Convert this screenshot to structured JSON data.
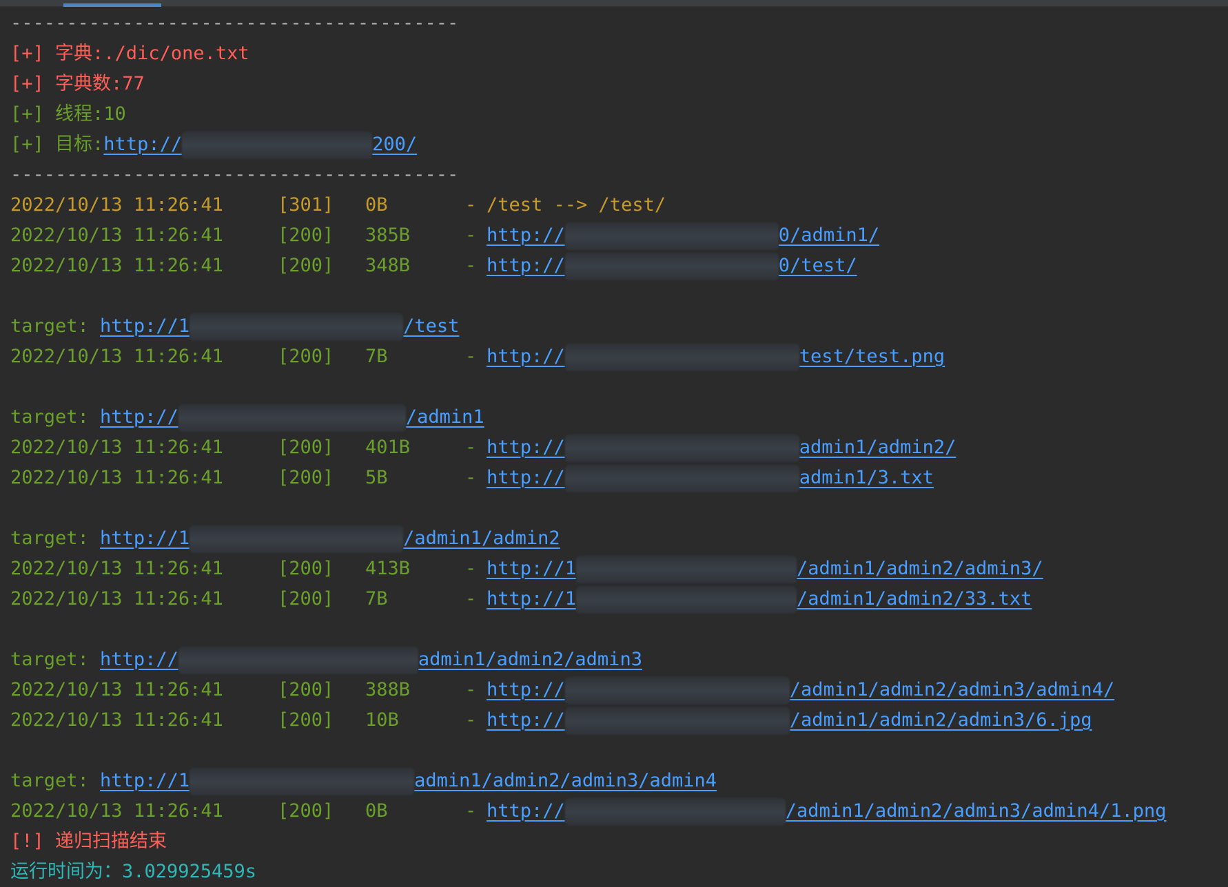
{
  "colors": {
    "background": "#2b2b2b",
    "error": "#ff5f56",
    "info": "#6a9f2b",
    "redirect": "#c49a2b",
    "link": "#4a9eff",
    "runtime": "#2fb6b6"
  },
  "header": {
    "separator": "----------------------------------------",
    "dict_prefix": "[+] ",
    "dict_label": "字典:",
    "dict_value": "./dic/one.txt",
    "dict_count_prefix": "[+] ",
    "dict_count_label": "字典数:",
    "dict_count_value": "77",
    "threads_prefix": "[+] ",
    "threads_label": "线程:",
    "threads_value": "10",
    "target_prefix": "[+] ",
    "target_label": "目标:",
    "target_url_start": "http://",
    "target_url_end": "200/"
  },
  "first_block": [
    {
      "date": "2022/10/13 11:26:41",
      "code": "[301]",
      "size": "0B",
      "dash": "-",
      "text": "/test --> /test/",
      "type": "redirect"
    },
    {
      "date": "2022/10/13 11:26:41",
      "code": "[200]",
      "size": "385B",
      "dash": "-",
      "url_start": "http://",
      "url_end": "0/admin1/",
      "type": "link"
    },
    {
      "date": "2022/10/13 11:26:41",
      "code": "[200]",
      "size": "348B",
      "dash": "-",
      "url_start": "http://",
      "url_end": "0/test/",
      "type": "link"
    }
  ],
  "targets": [
    {
      "label": "target: ",
      "url_start": "http://1",
      "url_end": "/test",
      "rows": [
        {
          "date": "2022/10/13 11:26:41",
          "code": "[200]",
          "size": "7B",
          "dash": "-",
          "url_start": "http://",
          "url_end": "test/test.png"
        }
      ]
    },
    {
      "label": "target: ",
      "url_start": "http://",
      "url_end": "/admin1",
      "rows": [
        {
          "date": "2022/10/13 11:26:41",
          "code": "[200]",
          "size": "401B",
          "dash": "-",
          "url_start": "http://",
          "url_end": "admin1/admin2/"
        },
        {
          "date": "2022/10/13 11:26:41",
          "code": "[200]",
          "size": "5B",
          "dash": "-",
          "url_start": "http://",
          "url_end": "admin1/3.txt"
        }
      ]
    },
    {
      "label": "target: ",
      "url_start": "http://1",
      "url_end": "/admin1/admin2",
      "rows": [
        {
          "date": "2022/10/13 11:26:41",
          "code": "[200]",
          "size": "413B",
          "dash": "-",
          "url_start": "http://1",
          "url_end": "/admin1/admin2/admin3/"
        },
        {
          "date": "2022/10/13 11:26:41",
          "code": "[200]",
          "size": "7B",
          "dash": "-",
          "url_start": "http://1",
          "url_end": "/admin1/admin2/33.txt"
        }
      ]
    },
    {
      "label": "target: ",
      "url_start": "http://",
      "url_end": "admin1/admin2/admin3",
      "rows": [
        {
          "date": "2022/10/13 11:26:41",
          "code": "[200]",
          "size": "388B",
          "dash": "-",
          "url_start": "http://",
          "url_end": "/admin1/admin2/admin3/admin4/"
        },
        {
          "date": "2022/10/13 11:26:41",
          "code": "[200]",
          "size": "10B",
          "dash": "-",
          "url_start": "http://",
          "url_end": "/admin1/admin2/admin3/6.jpg"
        }
      ]
    },
    {
      "label": "target: ",
      "url_start": "http://1",
      "url_end": "admin1/admin2/admin3/admin4",
      "rows": [
        {
          "date": "2022/10/13 11:26:41",
          "code": "[200]",
          "size": "0B",
          "dash": "-",
          "url_start": "http://",
          "url_end": "/admin1/admin2/admin3/admin4/1.png"
        }
      ]
    }
  ],
  "footer": {
    "done_prefix": "[!] ",
    "done_text": "递归扫描结束",
    "runtime_label": "运行时间为：",
    "runtime_value": "3.029925459s"
  }
}
